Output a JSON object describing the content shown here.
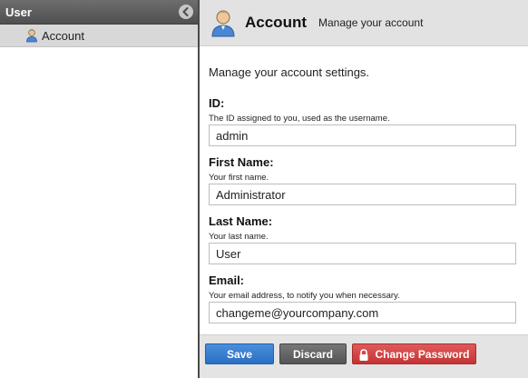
{
  "sidebar": {
    "title": "User",
    "items": [
      {
        "label": "Account",
        "icon": "user-icon"
      }
    ]
  },
  "main": {
    "title": "Account",
    "subtitle": "Manage your account",
    "intro": "Manage your account settings.",
    "fields": [
      {
        "label": "ID:",
        "description": "The ID assigned to you, used as the username.",
        "value": "admin"
      },
      {
        "label": "First Name:",
        "description": "Your first name.",
        "value": "Administrator"
      },
      {
        "label": "Last Name:",
        "description": "Your last name.",
        "value": "User"
      },
      {
        "label": "Email:",
        "description": "Your email address, to notify you when necessary.",
        "value": "changeme@yourcompany.com"
      }
    ]
  },
  "buttons": {
    "save": "Save",
    "discard": "Discard",
    "change_password": "Change Password"
  },
  "colors": {
    "save": "#2a6fc2",
    "discard": "#5c5c5c",
    "change_password": "#c43434"
  }
}
